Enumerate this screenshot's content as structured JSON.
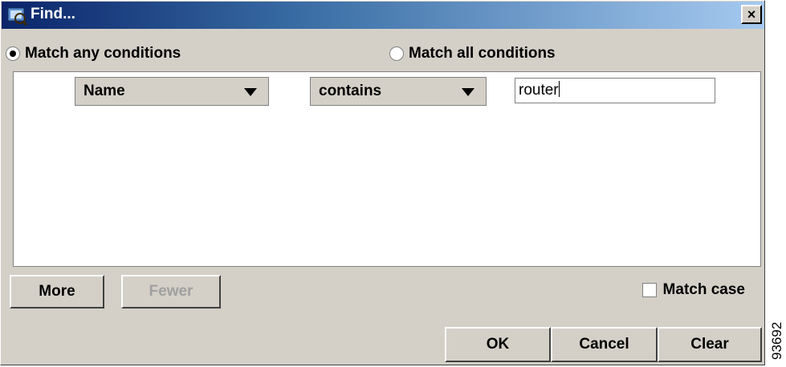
{
  "window": {
    "title": "Find...",
    "close_glyph": "×"
  },
  "match_mode": {
    "any_label": "Match any conditions",
    "all_label": "Match all conditions",
    "selected": "any"
  },
  "condition": {
    "field": "Name",
    "operator": "contains",
    "value": "router"
  },
  "buttons": {
    "more": "More",
    "fewer": "Fewer",
    "ok": "OK",
    "cancel": "Cancel",
    "clear": "Clear"
  },
  "match_case": {
    "label": "Match case",
    "checked": false
  },
  "figure_id": "93692",
  "icons": [
    "app-icon",
    "close-icon",
    "dropdown-arrow-icon"
  ],
  "colors": {
    "title_start": "#0a246a",
    "title_end": "#a6caf0",
    "face": "#d4d0c8"
  }
}
